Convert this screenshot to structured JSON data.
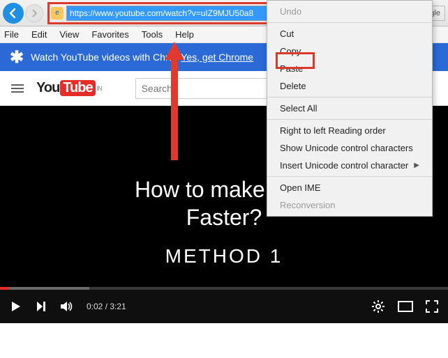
{
  "browser": {
    "url": "https://www.youtube.com/watch?v=uIZ9MJU50a8",
    "tab_title": "How To Make Google"
  },
  "menubar": {
    "items": [
      "File",
      "Edit",
      "View",
      "Favorites",
      "Tools",
      "Help"
    ]
  },
  "promo": {
    "text": "Watch YouTube videos with Chro",
    "link": "Yes, get Chrome"
  },
  "youtube": {
    "country": "IN",
    "logo_you": "You",
    "logo_tube": "Tube",
    "search_placeholder": "Search"
  },
  "video": {
    "title_line1": "How to make Goo",
    "title_line2": "Faster?",
    "method": "METHOD 1",
    "time_current": "0:02",
    "time_sep": " / ",
    "time_total": "3:21"
  },
  "context_menu": {
    "undo": "Undo",
    "cut": "Cut",
    "copy": "Copy",
    "paste": "Paste",
    "delete": "Delete",
    "select_all": "Select All",
    "rtl": "Right to left Reading order",
    "show_unicode": "Show Unicode control characters",
    "insert_unicode": "Insert Unicode control character",
    "open_ime": "Open IME",
    "reconversion": "Reconversion"
  }
}
